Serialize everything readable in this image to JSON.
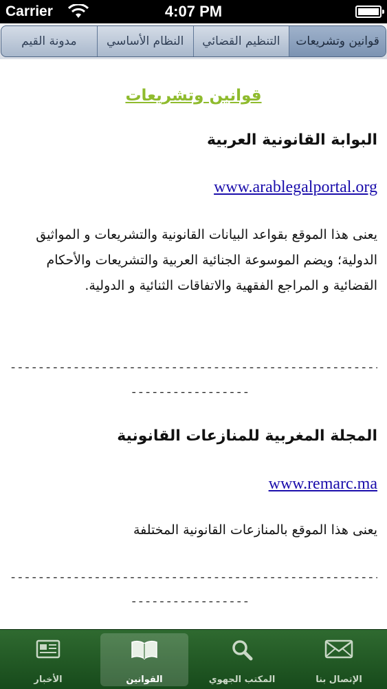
{
  "status_bar": {
    "carrier": "Carrier",
    "time": "4:07 PM"
  },
  "segments": [
    {
      "label": "قوانين وتشريعات",
      "active": true
    },
    {
      "label": "التنظيم القضائي",
      "active": false
    },
    {
      "label": "النظام الأساسي",
      "active": false
    },
    {
      "label": "مدونة القيم",
      "active": false
    }
  ],
  "content": {
    "title": "قوانين وتشريعات",
    "items": [
      {
        "name": "البوابة القانونية العربية",
        "url": "www.arablegalportal.org",
        "description": "يعنى هذا الموقع بقواعد البيانات القانونية والتشريعات و المواثيق الدولية؛ ويضم الموسوعة الجنائية العربية والتشريعات والأحكام القضائية و المراجع الفقهية والاتفاقات الثنائية و الدولية."
      },
      {
        "name": "المجلة المغربية للمنازعات القانونية",
        "url": "www.remarc.ma",
        "description": "يعنى هذا الموقع بالمنازعات القانونية المختلفة"
      }
    ],
    "separator_line1": "------------------------------------------------------------",
    "separator_line2": "-----------------"
  },
  "tabbar": [
    {
      "label": "الأخبار",
      "icon": "newspaper-icon",
      "active": false
    },
    {
      "label": "القوانين",
      "icon": "book-icon",
      "active": true
    },
    {
      "label": "المكتب الجهوي",
      "icon": "search-icon",
      "active": false
    },
    {
      "label": "الإتصال بنا",
      "icon": "envelope-icon",
      "active": false
    }
  ]
}
